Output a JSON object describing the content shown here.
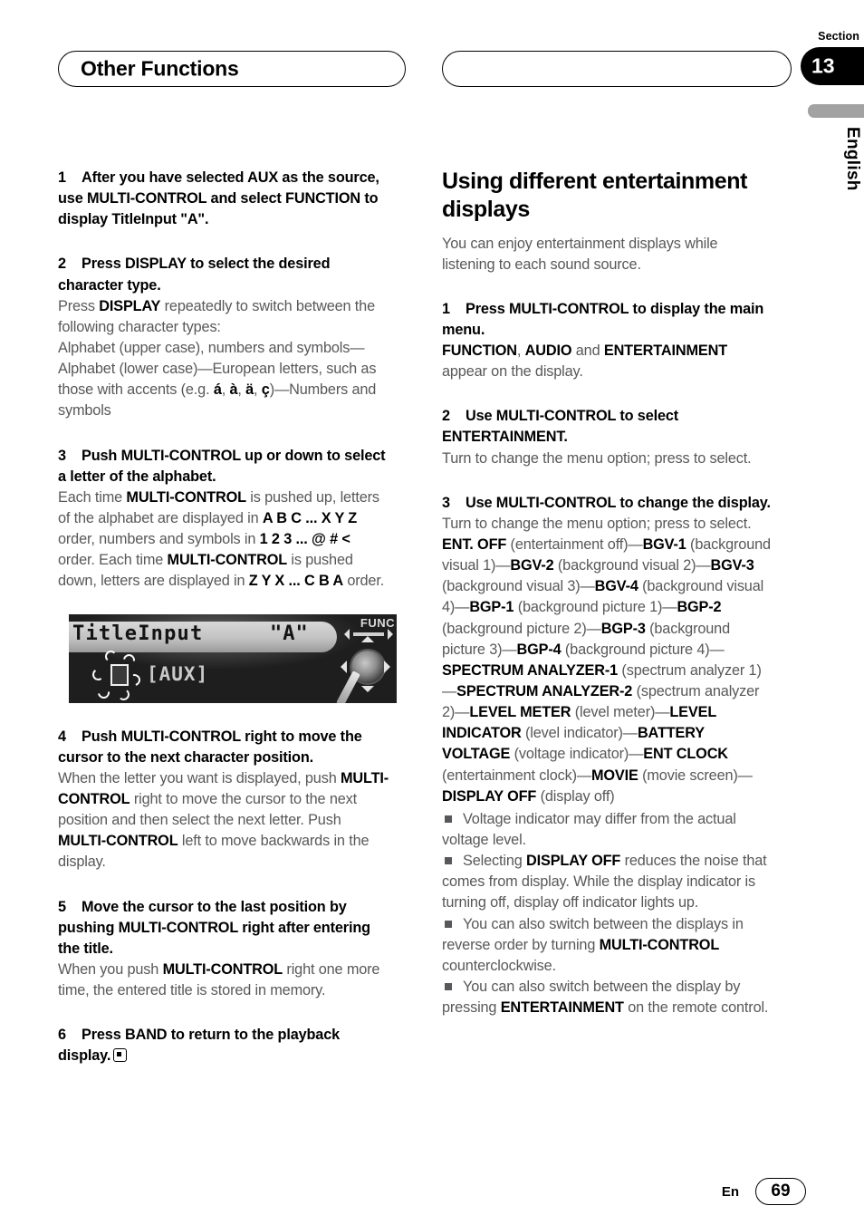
{
  "header": {
    "chapter_title": "Other Functions",
    "section_label": "Section",
    "section_number": "13",
    "language_tab": "English"
  },
  "footer": {
    "language_code": "En",
    "page_number": "69"
  },
  "left_column": {
    "step1": {
      "number": "1",
      "heading": "After you have selected AUX as the source, use MULTI-CONTROL and select FUNCTION to display TitleInput  \"A\"."
    },
    "step2": {
      "number": "2",
      "heading": "Press DISPLAY to select the desired character type.",
      "body_html": "Press <b>DISPLAY</b> repeatedly to switch between the following character types:<br>Alphabet (upper case), numbers and symbols—Alphabet (lower case)—European letters, such as those with accents (e.g. <b>á</b>, <b>à</b>, <b>ä</b>, <b>ç</b>)—Numbers and symbols"
    },
    "step3": {
      "number": "3",
      "heading": "Push MULTI-CONTROL up or down to select a letter of the alphabet.",
      "body_html": "Each time <b>MULTI-CONTROL</b> is pushed up, letters of the alphabet are displayed in <b>A B C ... X Y Z</b> order, numbers and symbols in <b>1 2 3 ... @ # &lt;</b> order. Each time <b>MULTI-CONTROL</b> is pushed down, letters are displayed in <b>Z Y X ... C B A</b> order."
    },
    "display_photo": {
      "title_text": "TitleInput",
      "character_text": "\"A\"",
      "source_text": "[AUX]",
      "func_label": "FUNC"
    },
    "step4": {
      "number": "4",
      "heading": "Push MULTI-CONTROL right to move the cursor to the next character position.",
      "body_html": "When the letter you want is displayed, push <b>MULTI-CONTROL</b> right to move the cursor to the next position and then select the next letter. Push <b>MULTI-CONTROL</b> left to move backwards in the display."
    },
    "step5": {
      "number": "5",
      "heading": "Move the cursor to the last position by pushing MULTI-CONTROL right after entering the title.",
      "body_html": "When you push <b>MULTI-CONTROL</b> right one more time, the entered title is stored in memory."
    },
    "step6": {
      "number": "6",
      "heading": "Press BAND to return to the playback display."
    }
  },
  "right_column": {
    "heading": "Using different entertainment displays",
    "intro": "You can enjoy entertainment displays while listening to each sound source.",
    "step1": {
      "number": "1",
      "heading": "Press MULTI-CONTROL to display the main menu.",
      "body_html": "<b>FUNCTION</b>, <b>AUDIO</b> and <b>ENTERTAINMENT</b> appear on the display."
    },
    "step2": {
      "number": "2",
      "heading": "Use MULTI-CONTROL to select ENTERTAINMENT.",
      "body_html": "Turn to change the menu option; press to select."
    },
    "step3": {
      "number": "3",
      "heading": "Use MULTI-CONTROL to change the display.",
      "body_html": "Turn to change the menu option; press to select.",
      "modes_html": "<b>ENT. OFF</b> (entertainment off)—<b>BGV-1</b> (background visual 1)—<b>BGV-2</b> (background visual 2)—<b>BGV-3</b> (background visual 3)—<b>BGV-4</b> (background visual 4)—<b>BGP-1</b> (background picture 1)—<b>BGP-2</b> (background picture 2)—<b>BGP-3</b> (background picture 3)—<b>BGP-4</b> (background picture 4)—<b>SPECTRUM ANALYZER-1</b> (spectrum analyzer 1)—<b>SPECTRUM ANALYZER-2</b> (spectrum analyzer 2)—<b>LEVEL METER</b> (level meter)—<b>LEVEL INDICATOR</b> (level indicator)—<b>BATTERY VOLTAGE</b> (voltage indicator)—<b>ENT CLOCK</b> (entertainment clock)—<b>MOVIE</b> (movie screen)—<b>DISPLAY OFF</b> (display off)"
    },
    "notes": [
      "Voltage indicator may differ from the actual voltage level.",
      "Selecting <b>DISPLAY OFF</b> reduces the noise that comes from display. While the display indicator is turning off, display off indicator lights up.",
      "You can also switch between the displays in reverse order by turning <b>MULTI-CONTROL</b> counterclockwise.",
      "You can also switch between the display by pressing <b>ENTERTAINMENT</b> on the remote control."
    ]
  }
}
